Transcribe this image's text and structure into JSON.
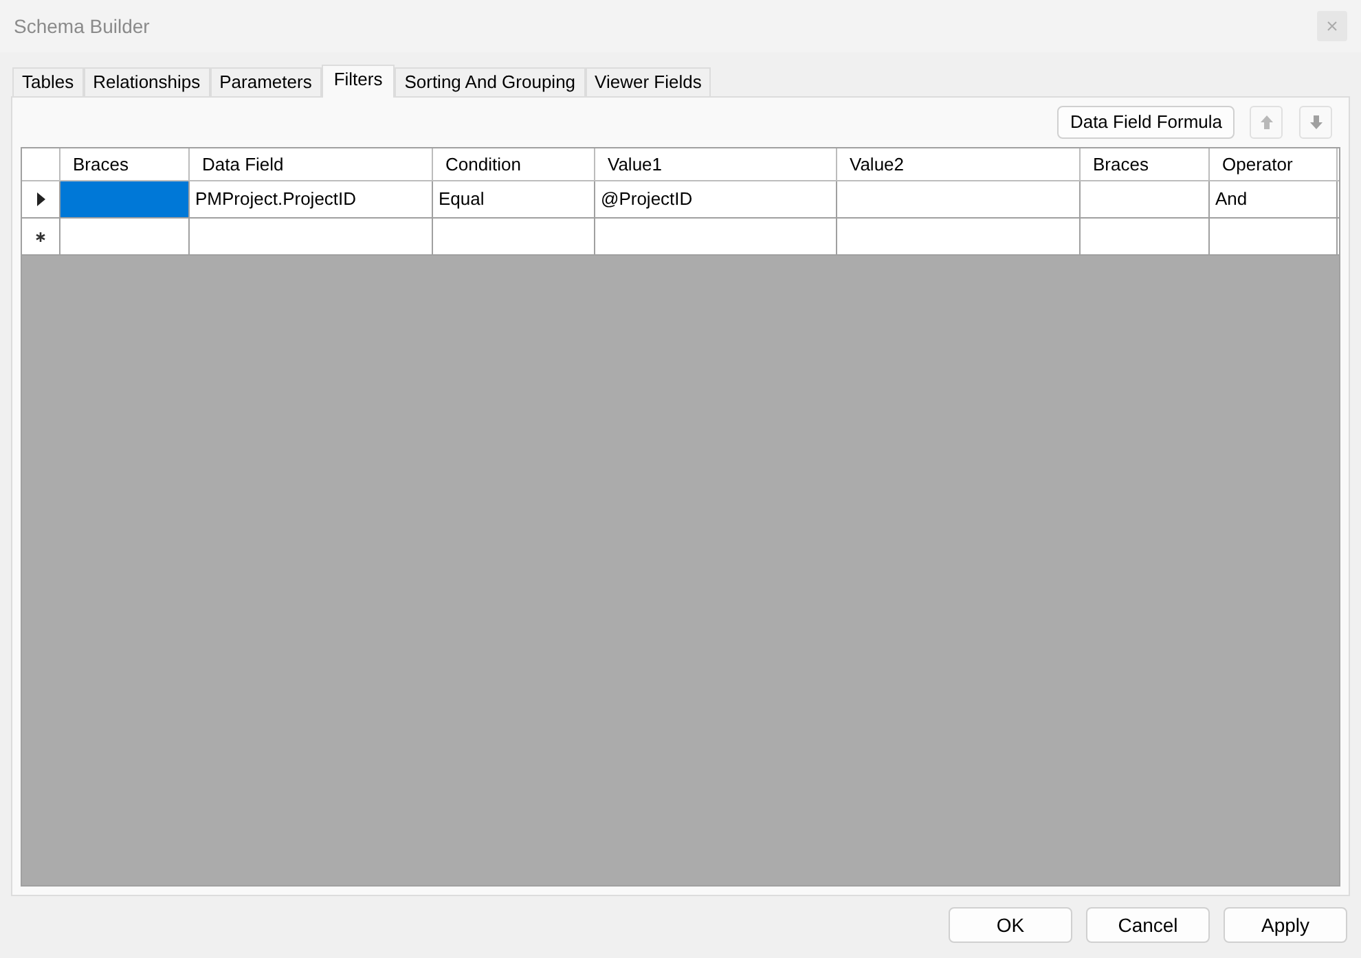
{
  "window": {
    "title": "Schema Builder"
  },
  "tabs": [
    {
      "label": "Tables",
      "selected": false
    },
    {
      "label": "Relationships",
      "selected": false
    },
    {
      "label": "Parameters",
      "selected": false
    },
    {
      "label": "Filters",
      "selected": true
    },
    {
      "label": "Sorting And Grouping",
      "selected": false
    },
    {
      "label": "Viewer Fields",
      "selected": false
    }
  ],
  "toolbar": {
    "formula_button": "Data Field Formula",
    "move_up_disabled": true,
    "move_down_disabled": true
  },
  "grid": {
    "columns": [
      "Braces",
      "Data Field",
      "Condition",
      "Value1",
      "Value2",
      "Braces",
      "Operator"
    ],
    "rows": [
      {
        "kind": "current",
        "cells": [
          {
            "selected": true
          },
          {
            "text": "PMProject.ProjectID",
            "selected": false
          },
          {
            "text": "Equal",
            "selected": false
          },
          {
            "text": "@ProjectID",
            "selected": false
          },
          {
            "selected": false
          },
          {
            "selected": false
          },
          {
            "text": "And",
            "selected": false
          }
        ]
      },
      {
        "kind": "new",
        "cells": [
          {
            "selected": false
          },
          {
            "selected": false
          },
          {
            "selected": false
          },
          {
            "selected": false
          },
          {
            "selected": false
          },
          {
            "selected": false
          },
          {
            "selected": false
          }
        ]
      }
    ]
  },
  "buttons": [
    "OK",
    "Cancel",
    "Apply"
  ]
}
